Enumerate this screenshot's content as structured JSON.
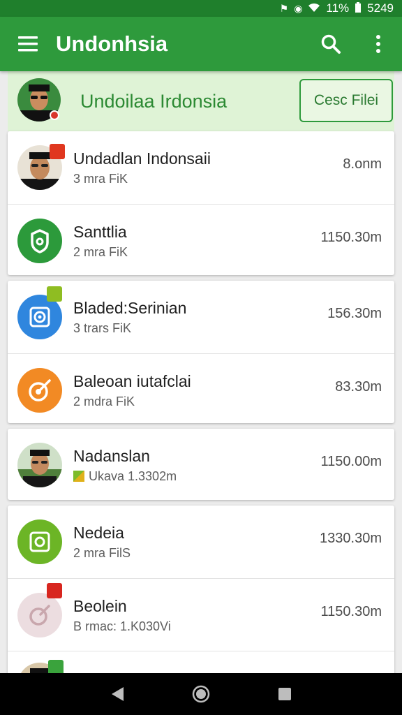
{
  "status_bar": {
    "battery": "11%",
    "time": "5249"
  },
  "app_bar": {
    "title": "Undonhsia"
  },
  "header": {
    "name": "Undoilaa Irdonsia",
    "close_label": "Cesc Filei"
  },
  "cards": [
    {
      "rows": [
        {
          "name": "Undadlan Indonsaii",
          "sub": "3 mra FiK",
          "time": "8.onm",
          "avatar_type": "person"
        },
        {
          "name": "Santtlia",
          "sub": "2 mra FiK",
          "time": "1150.30m",
          "avatar_type": "green-shield"
        }
      ]
    },
    {
      "rows": [
        {
          "name": "Bladed:Serinian",
          "sub": "3 trars FiK",
          "time": "156.30m",
          "avatar_type": "blue-target"
        },
        {
          "name": "Baleoan iutafclai",
          "sub": "2 mdra FiK",
          "time": "83.30m",
          "avatar_type": "orange-target"
        }
      ]
    },
    {
      "rows": [
        {
          "name": "Nadanslan",
          "sub": "Ukava 1.3302m",
          "time": "1150.00m",
          "avatar_type": "person-field"
        }
      ]
    },
    {
      "rows": [
        {
          "name": "Nedeia",
          "sub": "2 mra FilS",
          "time": "1330.30m",
          "avatar_type": "lime-box"
        },
        {
          "name": "Beolein",
          "sub": "B rmac: 1.K030Vi",
          "time": "1150.30m",
          "avatar_type": "pink-target"
        }
      ]
    }
  ],
  "colors": {
    "primary": "#2e9a3c",
    "status": "#1f7f2c",
    "header_bg": "#dff3d6",
    "accent_text": "#2c8a33"
  }
}
